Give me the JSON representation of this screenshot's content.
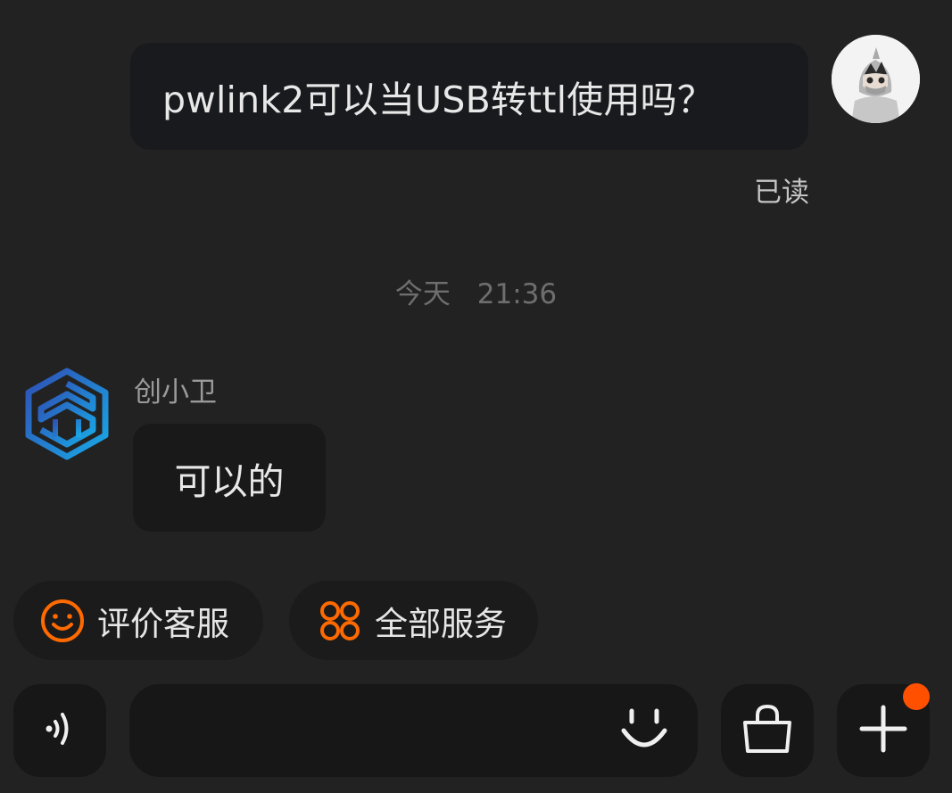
{
  "chat": {
    "outgoing_message": "pwlink2可以当USB转ttl使用吗？",
    "read_status": "已读",
    "timestamp": {
      "day": "今天",
      "time": "21:36"
    },
    "bot_name": "创小卫",
    "incoming_message": "可以的"
  },
  "quick_actions": [
    {
      "label": "评价客服",
      "icon": "smiley-face-icon"
    },
    {
      "label": "全部服务",
      "icon": "four-circles-grid-icon"
    }
  ],
  "input_bar": {
    "voice_icon": "voice-waves-icon",
    "emoji_icon": "emoji-face-icon",
    "bag_icon": "shopping-bag-icon",
    "plus_icon": "plus-icon"
  },
  "colors": {
    "background": "#222222",
    "bubble": "#191a1e",
    "accent": "#ff5000",
    "chip_icon": "#ff6a00"
  }
}
